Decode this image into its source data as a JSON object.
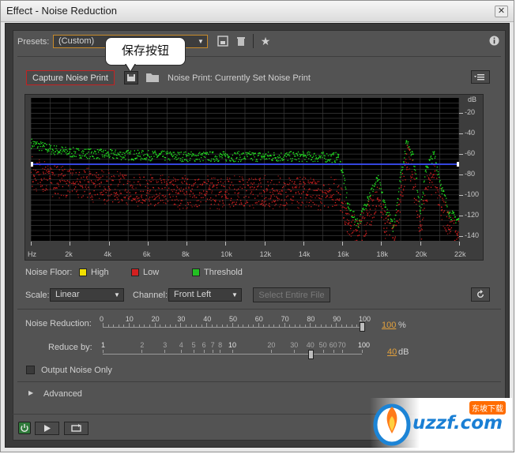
{
  "window": {
    "title": "Effect - Noise Reduction",
    "close_glyph": "✕"
  },
  "presets": {
    "label": "Presets:",
    "value": "(Custom)"
  },
  "tooltip": {
    "text": "保存按钮"
  },
  "capture": {
    "button_label": "Capture Noise Print",
    "noise_print_text": "Noise Print:  Currently Set Noise Print"
  },
  "graph": {
    "db_unit": "dB",
    "db_ticks": [
      "-20",
      "-40",
      "-60",
      "-80",
      "-100",
      "-120",
      "-140"
    ],
    "hz_ticks": [
      "Hz",
      "2k",
      "4k",
      "6k",
      "8k",
      "10k",
      "12k",
      "14k",
      "16k",
      "18k",
      "20k",
      "22k"
    ]
  },
  "chart_data": {
    "type": "scatter",
    "xlabel": "",
    "ylabel": "",
    "xlim": [
      0,
      22000
    ],
    "ylim": [
      -145,
      -5
    ],
    "x_unit": "Hz",
    "y_unit": "dB",
    "grid": true,
    "series": [
      {
        "name": "Threshold",
        "color": "#22e022",
        "x": [
          0,
          1000,
          2000,
          4000,
          6000,
          8000,
          10000,
          12000,
          14000,
          15800,
          16000,
          16300,
          16800,
          17300,
          17800,
          18200,
          18600,
          19000,
          19300,
          19600,
          20000,
          20300,
          20700,
          21100,
          21500,
          21900
        ],
        "y": [
          -49,
          -55,
          -58,
          -60,
          -61,
          -62,
          -62,
          -62,
          -62,
          -63,
          -78,
          -112,
          -128,
          -102,
          -84,
          -112,
          -132,
          -78,
          -47,
          -60,
          -115,
          -72,
          -60,
          -94,
          -118,
          -124
        ]
      },
      {
        "name": "Low",
        "color": "#d42020",
        "x": [
          0,
          1000,
          2000,
          4000,
          6000,
          8000,
          10000,
          12000,
          14000,
          15800,
          16000,
          16300,
          16800,
          17300,
          17800,
          18200,
          18600,
          19000,
          19300,
          19600,
          20000,
          20300,
          20700,
          21100,
          21500,
          21900
        ],
        "y": [
          -78,
          -84,
          -88,
          -92,
          -96,
          -97,
          -97,
          -97,
          -97,
          -98,
          -108,
          -128,
          -140,
          -120,
          -104,
          -128,
          -142,
          -100,
          -60,
          -80,
          -135,
          -94,
          -80,
          -112,
          -134,
          -138
        ]
      },
      {
        "name": "High",
        "color": "#f2e000",
        "x": [],
        "y": []
      },
      {
        "name": "level",
        "color": "#3c50ff",
        "x": [
          0,
          22000
        ],
        "y": [
          -70,
          -70
        ]
      }
    ]
  },
  "legend": {
    "label": "Noise Floor:",
    "high": "High",
    "low": "Low",
    "threshold": "Threshold",
    "high_color": "#f2e000",
    "low_color": "#d42020",
    "threshold_color": "#22c022"
  },
  "scale": {
    "label": "Scale:",
    "value": "Linear"
  },
  "channel": {
    "label": "Channel:",
    "value": "Front Left"
  },
  "select_entire_file": "Select Entire File",
  "noise_reduction": {
    "label": "Noise Reduction:",
    "ticks": [
      "0",
      "10",
      "20",
      "30",
      "40",
      "50",
      "60",
      "70",
      "80",
      "90",
      "100"
    ],
    "value": "100",
    "unit": "%",
    "fraction": 1.0
  },
  "reduce_by": {
    "label": "Reduce by:",
    "ticks": [
      "1",
      "2",
      "3",
      "4",
      "5",
      "6",
      "7",
      "8",
      "10",
      "20",
      "30",
      "40",
      "50",
      "60",
      "70",
      "100"
    ],
    "value": "40",
    "unit": "dB",
    "level": 40
  },
  "output_noise_only": {
    "label": "Output Noise Only",
    "checked": false
  },
  "advanced": {
    "label": "Advanced"
  },
  "watermark": {
    "text": "uzzf.com",
    "sub": "东坡下载"
  }
}
